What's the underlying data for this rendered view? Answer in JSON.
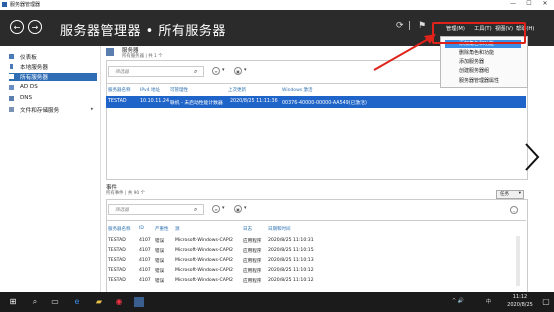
{
  "window": {
    "title": "服务器管理器",
    "minimize": "—",
    "maximize": "☐",
    "close": "✕"
  },
  "header": {
    "back": "←",
    "forward": "→",
    "breadcrumb": "服务器管理器 • 所有服务器",
    "refresh_icon": "⟳",
    "separator": "|",
    "flag_icon": "⚑",
    "menu": {
      "manage": "管理(M)",
      "tools": "工具(T)",
      "view": "视图(V)",
      "help": "帮助(H)"
    }
  },
  "dropdown": {
    "items": [
      "添加角色和功能",
      "删除角色和功能",
      "添加服务器",
      "创建服务器组",
      "服务器管理器属性"
    ]
  },
  "sidebar": {
    "items": [
      {
        "label": "仪表板",
        "icon": "dashboard-icon"
      },
      {
        "label": "本地服务器",
        "icon": "server-icon"
      },
      {
        "label": "所有服务器",
        "icon": "servers-icon"
      },
      {
        "label": "AD DS",
        "icon": "ad-icon"
      },
      {
        "label": "DNS",
        "icon": "dns-icon"
      },
      {
        "label": "文件和存储服务",
        "icon": "storage-icon",
        "chevron": "▸"
      }
    ]
  },
  "servers": {
    "title": "服务器",
    "subtitle": "所有服务器 | 共 1 个",
    "filter_placeholder": "筛选器",
    "columns": [
      "服务器名称",
      "IPv4 地址",
      "可管理性",
      "上次更新",
      "Windows 激活"
    ],
    "row": {
      "name": "TESTAD",
      "ip": "10.10.11.24",
      "status": "联机 - 未启动性能计数器",
      "updated": "2020/8/25 11:11:36",
      "activation": "00376-40000-00000-AA549(已激活)"
    }
  },
  "events": {
    "title": "事件",
    "subtitle": "所有事件 | 共 90 个",
    "tasks_label": "任务",
    "filter_placeholder": "筛选器",
    "columns": [
      "服务器名称",
      "ID",
      "严重性",
      "源",
      "日志",
      "日期和时间"
    ],
    "rows": [
      [
        "TESTAD",
        "4107",
        "错误",
        "Microsoft-Windows-CAPI2",
        "应用程序",
        "2020/8/25 11:10:31"
      ],
      [
        "TESTAD",
        "4107",
        "错误",
        "Microsoft-Windows-CAPI2",
        "应用程序",
        "2020/8/25 11:10:15"
      ],
      [
        "TESTAD",
        "4107",
        "错误",
        "Microsoft-Windows-CAPI2",
        "应用程序",
        "2020/8/25 11:10:13"
      ],
      [
        "TESTAD",
        "4107",
        "错误",
        "Microsoft-Windows-CAPI2",
        "应用程序",
        "2020/8/25 11:10:12"
      ],
      [
        "TESTAD",
        "4107",
        "错误",
        "Microsoft-Windows-CAPI2",
        "应用程序",
        "2020/8/25 11:10:12"
      ]
    ]
  },
  "taskbar": {
    "time": "11:12",
    "date": "2020/8/25",
    "lang": "中",
    "tray": "^ 🔊"
  },
  "colors": {
    "header_bg": "#2b2b2b",
    "accent": "#1f64c8",
    "annotation": "#e0231a"
  }
}
